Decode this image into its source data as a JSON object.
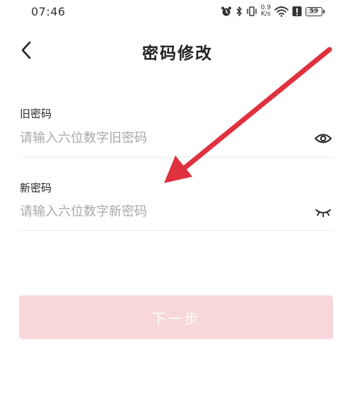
{
  "status_bar": {
    "time": "07:46",
    "net_speed_value": "0.9",
    "net_speed_unit": "K/s",
    "battery_level": "59",
    "battery_fraction": 0.59,
    "icons": [
      "alarm-icon",
      "bluetooth-icon",
      "vibrate-icon",
      "wifi-icon",
      "alert-icon",
      "battery-icon"
    ]
  },
  "header": {
    "title": "密码修改",
    "back_icon": "chevron-left-icon"
  },
  "form": {
    "old_password": {
      "label": "旧密码",
      "placeholder": "请输入六位数字旧密码",
      "value": "",
      "toggle_icon": "eye-open-icon"
    },
    "new_password": {
      "label": "新密码",
      "placeholder": "请输入六位数字新密码",
      "value": "",
      "toggle_icon": "eye-closed-icon"
    }
  },
  "actions": {
    "next_label": "下一步"
  },
  "colors": {
    "next_button_bg": "#f7d7d9",
    "annotation_arrow": "#e0313f"
  }
}
